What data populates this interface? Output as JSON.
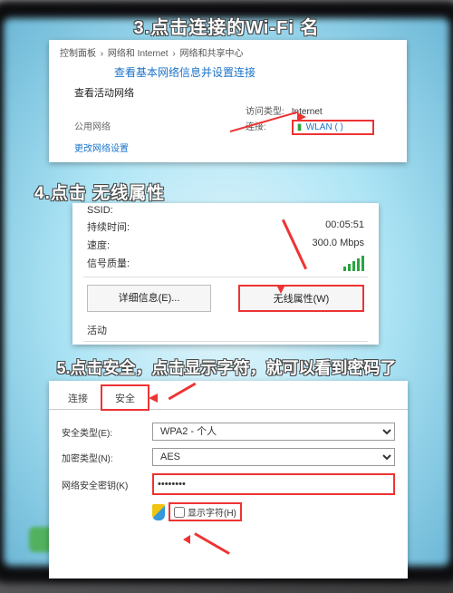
{
  "steps": {
    "s3": "3.点击连接的Wi-Fi 名",
    "s4": "4.点击 无线属性",
    "s5": "5.点击安全，点击显示字符，就可以看到密码了"
  },
  "panel1": {
    "crumb_a": "控制面板",
    "crumb_b": "网络和 Internet",
    "crumb_c": "网络和共享中心",
    "headline": "查看基本网络信息并设置连接",
    "active_nets": "查看活动网络",
    "net_type": "公用网络",
    "acc_label": "访问类型:",
    "acc_value": "Internet",
    "conn_label": "连接:",
    "conn_value": "WLAN (            )",
    "adapter": "更改网络设置"
  },
  "panel2": {
    "ssid_k": "SSID:",
    "ssid_v": "",
    "dur_k": "持续时间:",
    "dur_v": "00:05:51",
    "spd_k": "速度:",
    "spd_v": "300.0 Mbps",
    "qual_k": "信号质量:",
    "btn_detail": "详细信息(E)...",
    "btn_props": "无线属性(W)",
    "activity": "活动"
  },
  "panel3": {
    "tab_conn": "连接",
    "tab_sec": "安全",
    "sec_type_l": "安全类型(E):",
    "sec_type_v": "WPA2 - 个人",
    "enc_type_l": "加密类型(N):",
    "enc_type_v": "AES",
    "key_l": "网络安全密钥(K)",
    "key_v": "●●●●●●●●",
    "show_chars": "显示字符(H)"
  }
}
